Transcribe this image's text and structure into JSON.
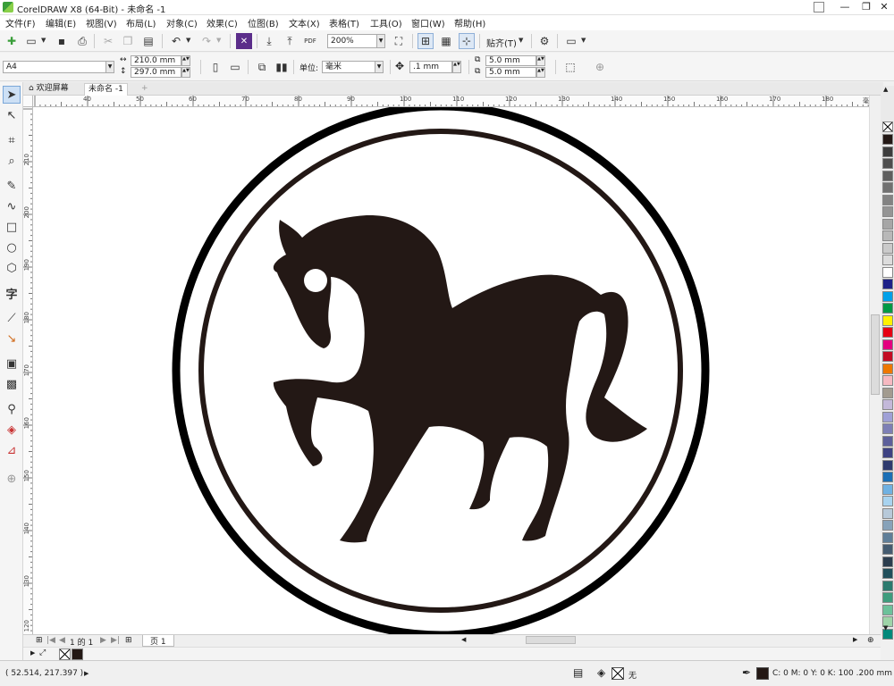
{
  "window": {
    "title": "CorelDRAW X8 (64-Bit) - 未命名 -1",
    "minimize_glyph": "—",
    "restore_glyph": "❐",
    "close_glyph": "✕"
  },
  "menu": [
    "文件(F)",
    "编辑(E)",
    "视图(V)",
    "布局(L)",
    "对象(C)",
    "效果(C)",
    "位图(B)",
    "文本(X)",
    "表格(T)",
    "工具(O)",
    "窗口(W)",
    "帮助(H)"
  ],
  "toolbar": {
    "pdf_label": "PDF",
    "zoom_value": "200%",
    "snap_label": "贴齐(T)"
  },
  "property_bar": {
    "page_size": "A4",
    "width": "210.0 mm",
    "height": "297.0 mm",
    "units_label": "单位:",
    "units_value": "毫米",
    "nudge": ".1 mm",
    "dup_x": "5.0 mm",
    "dup_y": "5.0 mm"
  },
  "tabs": [
    {
      "label": "欢迎屏幕"
    },
    {
      "label": "未命名 -1"
    }
  ],
  "ruler": {
    "unit_label": "毫米",
    "h_labels": [
      "40",
      "50",
      "60",
      "70",
      "80",
      "90",
      "100",
      "110",
      "120",
      "130",
      "140",
      "150",
      "160",
      "170",
      "180"
    ],
    "v_labels": [
      "210",
      "200",
      "190",
      "180",
      "170",
      "160",
      "150",
      "140",
      "130",
      "120"
    ]
  },
  "page_nav": {
    "counter": "1 的 1",
    "page_tab": "页 1"
  },
  "status": {
    "coordinates": "( 52.514, 217.397 )",
    "fill_none": "无",
    "outline_info": "C: 0 M: 0 Y: 0 K: 100  .200 mm"
  },
  "colors": {
    "accent": "#3478c6",
    "horse": "#231815",
    "ring": "#000000",
    "palette": [
      "#231815",
      "#3c3c3c",
      "#4d4d4d",
      "#5e5e5e",
      "#707070",
      "#828282",
      "#949494",
      "#a6a6a6",
      "#b8b8b8",
      "#cacaca",
      "#dcdcdc",
      "#ffffff",
      "#1d2088",
      "#00a0e9",
      "#009944",
      "#fff100",
      "#e60012",
      "#e4007f",
      "#c30d23",
      "#ee7800",
      "#f6b9c1",
      "#a29b8f",
      "#c3b8d9",
      "#9fa0d6",
      "#7d7fb6",
      "#5c5f9a",
      "#3d4282",
      "#2e3a6e",
      "#1b6fb5",
      "#6fb1e2",
      "#a8d3ef",
      "#b7c9d9",
      "#87a2b9",
      "#5f7e98",
      "#445b70",
      "#2b3d4e",
      "#1f4e5a",
      "#2b7a6e",
      "#3e9c7d",
      "#6cc19a",
      "#9ed4a8",
      "#00897b"
    ]
  }
}
